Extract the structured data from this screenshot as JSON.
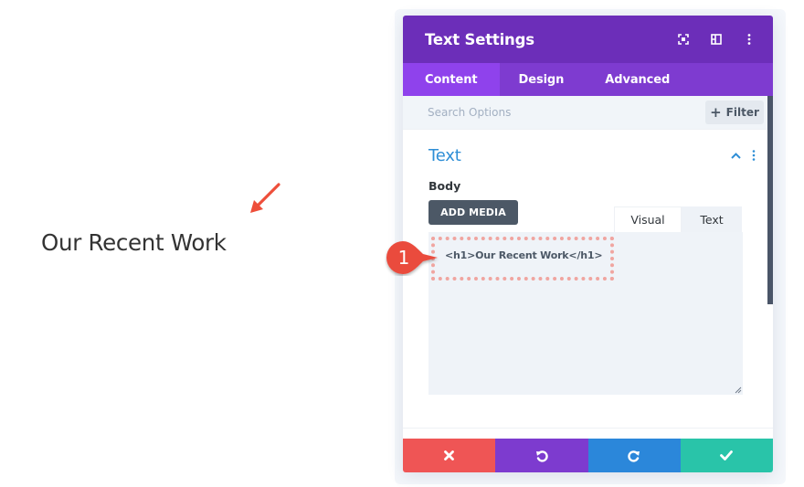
{
  "preview": {
    "heading": "Our Recent Work"
  },
  "modal": {
    "title": "Text Settings",
    "header_icons": [
      "expand-icon",
      "split-view-icon",
      "more-vertical-icon"
    ],
    "tabs": [
      {
        "label": "Content",
        "active": true
      },
      {
        "label": "Design",
        "active": false
      },
      {
        "label": "Advanced",
        "active": false
      }
    ],
    "search": {
      "placeholder": "Search Options",
      "value": ""
    },
    "filter_label": "Filter",
    "section": {
      "title": "Text",
      "expanded": true
    },
    "field": {
      "label": "Body",
      "add_media_label": "ADD MEDIA",
      "editor_tabs": [
        {
          "label": "Visual",
          "active": false
        },
        {
          "label": "Text",
          "active": true
        }
      ],
      "value": "<h1>Our Recent Work</h1>"
    },
    "footer_buttons": [
      {
        "name": "cancel",
        "icon": "close-icon",
        "color": "#ef5555"
      },
      {
        "name": "undo",
        "icon": "undo-icon",
        "color": "#7d3bcf"
      },
      {
        "name": "redo",
        "icon": "redo-icon",
        "color": "#2b87da"
      },
      {
        "name": "save",
        "icon": "check-icon",
        "color": "#29c4a9"
      }
    ]
  },
  "annotation": {
    "badge_number": "1",
    "arrow_color": "#ee4e3a"
  },
  "colors": {
    "header": "#6c2eb9",
    "tabs_bar": "#7e3bd0",
    "active_tab": "#8f42ec",
    "section_title": "#2e8ed6"
  }
}
